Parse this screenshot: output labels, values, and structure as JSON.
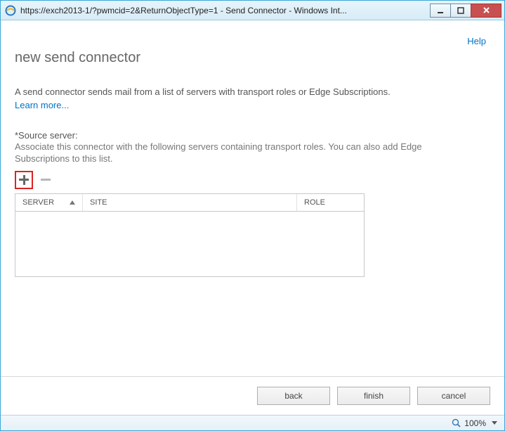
{
  "window": {
    "title": "https://exch2013-1/?pwmcid=2&ReturnObjectType=1 - Send Connector - Windows Int..."
  },
  "help_label": "Help",
  "page_title": "new send connector",
  "description": "A send connector sends mail from a list of servers with transport roles or Edge Subscriptions.",
  "learn_more": "Learn more...",
  "source_label": "*Source server:",
  "source_help": "Associate this connector with the following servers containing transport roles. You can also add Edge Subscriptions to this list.",
  "columns": {
    "server": "SERVER",
    "site": "SITE",
    "role": "ROLE"
  },
  "buttons": {
    "back": "back",
    "finish": "finish",
    "cancel": "cancel"
  },
  "status": {
    "zoom": "100%"
  }
}
